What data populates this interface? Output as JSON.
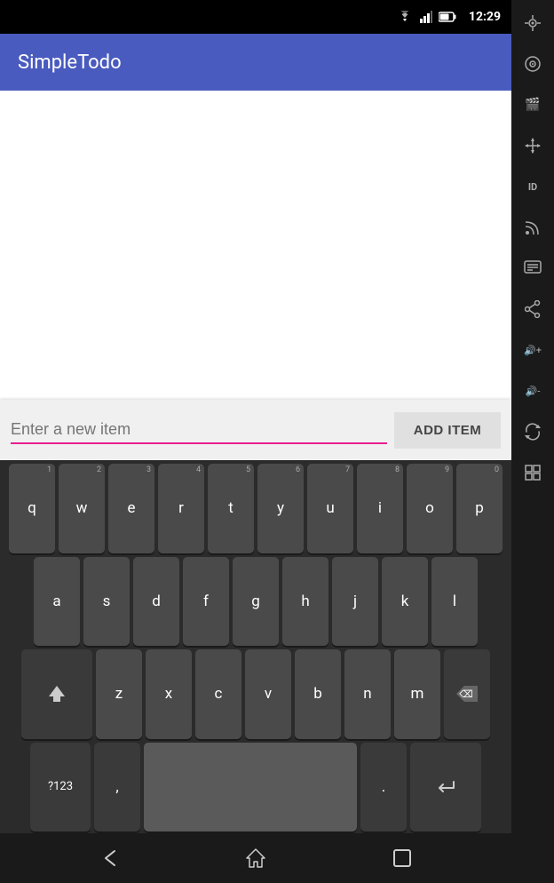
{
  "app": {
    "title": "SimpleTodo"
  },
  "status_bar": {
    "time": "12:29",
    "battery_icon": "🔋",
    "wifi_icon": "WiFi",
    "signal_icon": "▲"
  },
  "input": {
    "placeholder": "Enter a new item",
    "value": ""
  },
  "add_button": {
    "label": "ADD ITEM"
  },
  "keyboard": {
    "row1": [
      "q",
      "w",
      "e",
      "r",
      "t",
      "y",
      "u",
      "i",
      "o",
      "p"
    ],
    "row1_nums": [
      "1",
      "2",
      "3",
      "4",
      "5",
      "6",
      "7",
      "8",
      "9",
      "0"
    ],
    "row2": [
      "a",
      "s",
      "d",
      "f",
      "g",
      "h",
      "j",
      "k",
      "l"
    ],
    "row3": [
      "z",
      "x",
      "c",
      "v",
      "b",
      "n",
      "m"
    ],
    "sym_key": "?123",
    "comma_key": ",",
    "space_key": "",
    "period_key": ".",
    "enter_key": "↵",
    "shift_key": "⇧",
    "delete_key": "⌫"
  },
  "system_icons": [
    {
      "name": "gps",
      "symbol": "⊕"
    },
    {
      "name": "camera",
      "symbol": "◎"
    },
    {
      "name": "video",
      "symbol": "🎬"
    },
    {
      "name": "move",
      "symbol": "✛"
    },
    {
      "name": "id",
      "symbol": "ID"
    },
    {
      "name": "rss",
      "symbol": "◉"
    },
    {
      "name": "chat",
      "symbol": "▦"
    },
    {
      "name": "share",
      "symbol": "⎇"
    },
    {
      "name": "volume-up",
      "symbol": "🔊+"
    },
    {
      "name": "volume-down",
      "symbol": "🔊-"
    },
    {
      "name": "rotate",
      "symbol": "⟳"
    },
    {
      "name": "scale",
      "symbol": "⊞"
    }
  ],
  "nav": {
    "back": "◁",
    "home": "△",
    "recent": "□"
  }
}
